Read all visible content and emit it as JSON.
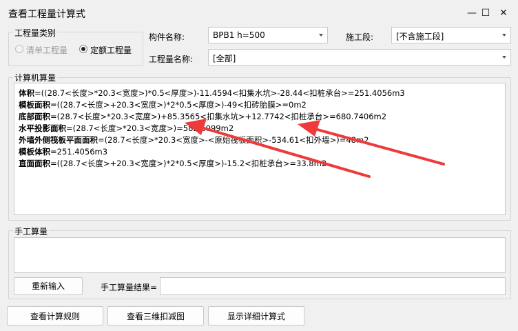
{
  "window": {
    "title": "查看工程量计算式",
    "minimize_glyph": "—",
    "maximize_glyph": "☐",
    "close_glyph": "✕"
  },
  "quantity_type": {
    "group_label": "工程量类别",
    "option_bill": "清单工程量",
    "option_quota": "定额工程量",
    "selected": "定额工程量"
  },
  "component": {
    "label": "构件名称:",
    "value": "BPB1 h=500"
  },
  "stage": {
    "label": "施工段:",
    "value": "[不含施工段]"
  },
  "quantity_name": {
    "label": "工程量名称:",
    "value": "[全部]"
  },
  "computer_calc": {
    "group_label": "计算机算量",
    "lines": [
      {
        "name": "体积",
        "formula": "=((28.7<长度>*20.3<宽度>)*0.5<厚度>)-11.4594<扣集水坑>-28.44<扣桩承台>=251.4056m3"
      },
      {
        "name": "模板面积",
        "formula": "=((28.7<长度>+20.3<宽度>)*2*0.5<厚度>)-49<扣砖胎膜>=0m2"
      },
      {
        "name": "底部面积",
        "formula": "=(28.7<长度>*20.3<宽度>)+85.3565<扣集水坑>+12.7742<扣桩承台>=680.7406m2"
      },
      {
        "name": "水平投影面积",
        "formula": "=(28.7<长度>*20.3<宽度>)=582.6099m2"
      },
      {
        "name": "外墙外侧筏板平面面积",
        "formula": "=(28.7<长度>*20.3<宽度>-<原始筏板面积>-534.61<扣外墙>)=48m2"
      },
      {
        "name": "模板体积",
        "formula": "=251.4056m3"
      },
      {
        "name": "直面面积",
        "formula": "=((28.7<长度>+20.3<宽度>)*2*0.5<厚度>)-15.2<扣桩承台>=33.8m2"
      }
    ]
  },
  "manual_calc": {
    "group_label": "手工算量",
    "reenter_button": "重新输入",
    "result_label": "手工算量结果=",
    "result_value": ""
  },
  "footer": {
    "view_rules_button": "查看计算规则",
    "view_3d_button": "查看三维扣减图",
    "show_detail_button": "显示详细计算式"
  },
  "annotation": {
    "arrow_color": "#ee3a3a"
  }
}
